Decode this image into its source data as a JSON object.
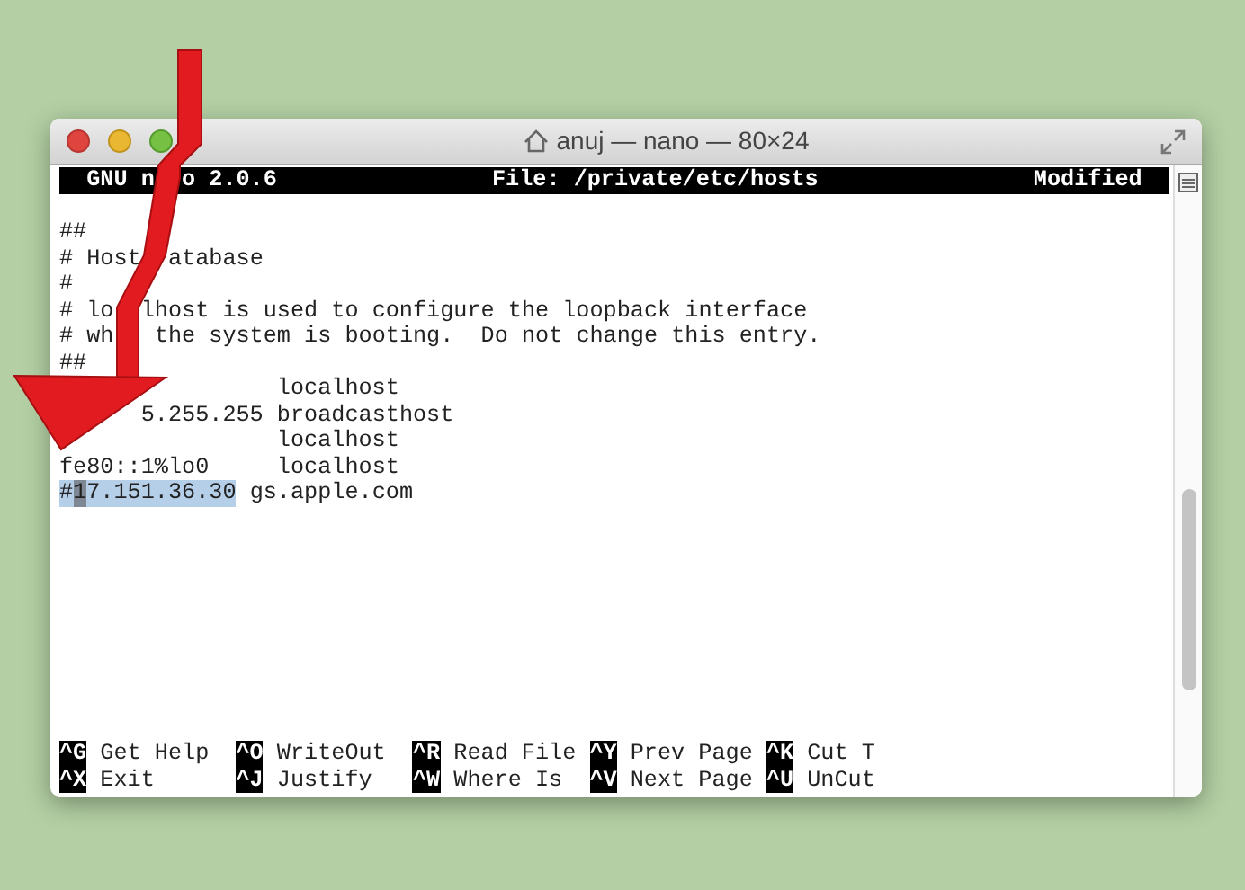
{
  "window": {
    "title": "anuj — nano — 80×24"
  },
  "header": {
    "version": [
      "GNU n",
      "o 2.0.6"
    ],
    "file": "File: /private/etc/hosts",
    "status": "Modified"
  },
  "lines": [
    {
      "fragments": [
        {
          "text": "##",
          "selected": false,
          "cursor": false
        }
      ]
    },
    {
      "fragments": [
        {
          "text": "# Host",
          "selected": false,
          "cursor": false
        },
        {
          "text": "atabase",
          "selected": false,
          "cursor": false
        }
      ]
    },
    {
      "fragments": [
        {
          "text": "#",
          "selected": false,
          "cursor": false
        }
      ]
    },
    {
      "fragments": [
        {
          "text": "# lo",
          "selected": false,
          "cursor": false
        },
        {
          "text": "lhost is used to configure the loopback interface",
          "selected": false,
          "cursor": false
        }
      ]
    },
    {
      "fragments": [
        {
          "text": "# wh",
          "selected": false,
          "cursor": false
        },
        {
          "text": "the system is booting.  Do not change this entry.",
          "selected": false,
          "cursor": false
        }
      ]
    },
    {
      "fragments": [
        {
          "text": "##",
          "selected": false,
          "cursor": false
        }
      ]
    },
    {
      "fragments": [
        {
          "text": "localhost",
          "selected": false,
          "cursor": false
        }
      ]
    },
    {
      "fragments": [
        {
          "text": "5.255.255",
          "selected": false,
          "cursor": false
        },
        {
          "text": "broadcasthost",
          "selected": false,
          "cursor": false
        }
      ]
    },
    {
      "fragments": [
        {
          "text": "localhost",
          "selected": false,
          "cursor": false
        }
      ]
    },
    {
      "fragments": [
        {
          "text": "fe80::1%lo0",
          "selected": false,
          "cursor": false
        },
        {
          "text": "localhost",
          "selected": false,
          "cursor": false
        }
      ]
    },
    {
      "fragments": [
        {
          "text": "#",
          "selected": true,
          "cursor": false
        },
        {
          "text": "1",
          "selected": true,
          "cursor": true
        },
        {
          "text": "7.151.36.30",
          "selected": true,
          "cursor": false
        },
        {
          "text": "gs.apple.com",
          "selected": false,
          "cursor": false
        }
      ]
    }
  ],
  "shortcuts": [
    {
      "key": "^G",
      "label": "Get Help"
    },
    {
      "key": "^O",
      "label": "WriteOut"
    },
    {
      "key": "^R",
      "label": "Read File"
    },
    {
      "key": "^Y",
      "label": "Prev Page"
    },
    {
      "key": "^K",
      "label": "Cut T"
    },
    {
      "key": "^X",
      "label": "Exit"
    },
    {
      "key": "^J",
      "label": "Justify"
    },
    {
      "key": "^W",
      "label": "Where Is"
    },
    {
      "key": "^V",
      "label": "Next Page"
    },
    {
      "key": "^U",
      "label": "UnCut"
    }
  ]
}
